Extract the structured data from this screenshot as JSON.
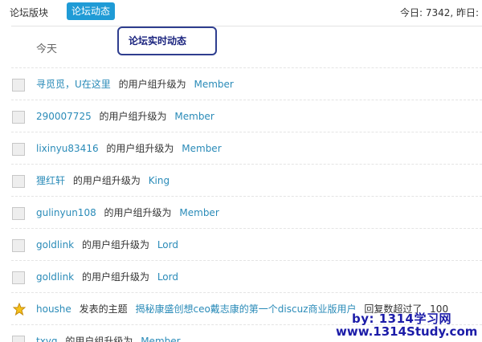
{
  "tabs": {
    "forum_sections": "论坛版块",
    "forum_activity": "论坛动态"
  },
  "stats": "今日: 7342, 昨日:",
  "callout": "论坛实时动态",
  "day_header": "今天",
  "feed": [
    {
      "user": "寻觅觅，U在这里",
      "action": "的用户组升级为",
      "value": "Member"
    },
    {
      "user": "290007725",
      "action": "的用户组升级为",
      "value": "Member"
    },
    {
      "user": "lixinyu83416",
      "action": "的用户组升级为",
      "value": "Member"
    },
    {
      "user": "狸红轩",
      "action": "的用户组升级为",
      "value": "King"
    },
    {
      "user": "gulinyun108",
      "action": "的用户组升级为",
      "value": "Member"
    },
    {
      "user": "goldlink",
      "action": "的用户组升级为",
      "value": "Lord"
    },
    {
      "user": "goldlink",
      "action": "的用户组升级为",
      "value": "Lord"
    },
    {
      "user": "houshe",
      "action": "发表的主题",
      "topic": "揭秘康盛创想ceo戴志康的第一个discuz商业版用户",
      "suffix": "回复数超过了",
      "count": "100"
    },
    {
      "user": "txyq",
      "action": "的用户组升级为",
      "value": "Member"
    }
  ],
  "watermark": {
    "line1": "by: 1314学习网",
    "line2": "www.1314Study.com"
  },
  "colors": {
    "accent": "#1f9bd6",
    "link": "#2a8bb8",
    "callout_border": "#2f3e8f",
    "star": "#f6c21a"
  }
}
